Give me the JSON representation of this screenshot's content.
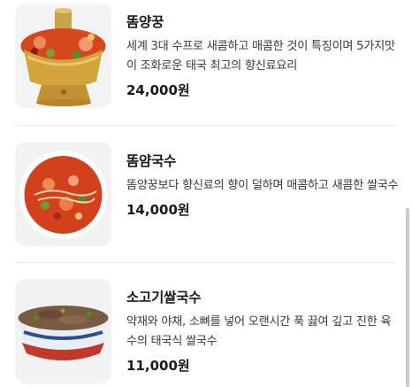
{
  "menu": {
    "items": [
      {
        "name": "똠양꿍",
        "description": "세계 3대 수프로 새콤하고 매콤한 것이 특징이며 5가지맛이 조화로운 태국 최고의 향신료요리",
        "price": "24,000원"
      },
      {
        "name": "똠얌국수",
        "description": "똠양꿍보다 향신료의 향이 덜하며 매콤하고 새콤한 쌀국수",
        "price": "14,000원"
      },
      {
        "name": "소고기쌀국수",
        "description": "약재와 야채, 소뼈를 넣어 오랜시간 푹 끓여 깊고 진한 육수의 태국식 쌀국수",
        "price": "11,000원"
      }
    ]
  }
}
